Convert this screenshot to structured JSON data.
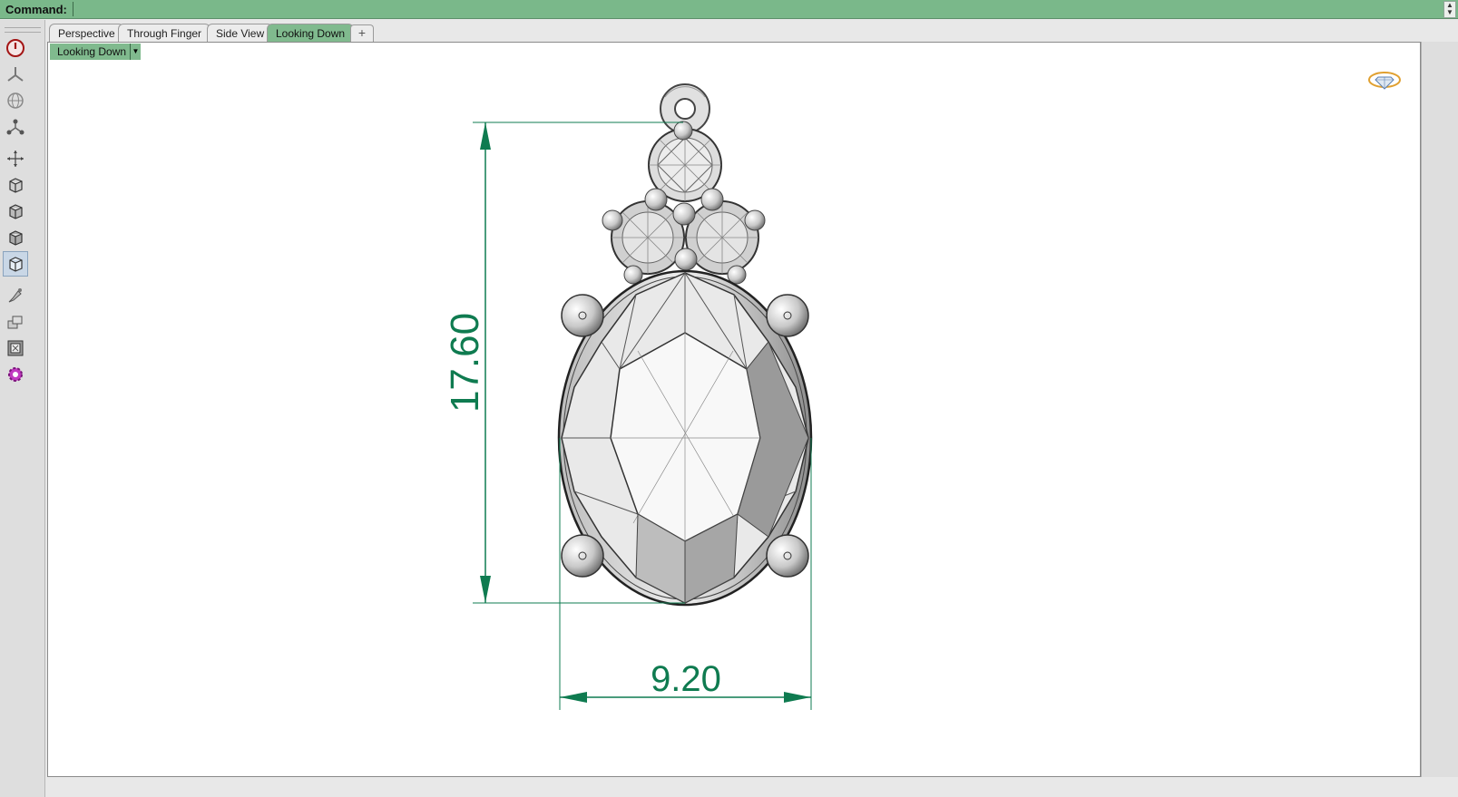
{
  "command_bar": {
    "label": "Command:",
    "value": ""
  },
  "tabs": [
    {
      "label": "Perspective"
    },
    {
      "label": "Through Finger"
    },
    {
      "label": "Side View"
    },
    {
      "label": "Looking Down"
    }
  ],
  "active_tab": "Looking Down",
  "viewport": {
    "label": "Looking Down",
    "dimensions": {
      "height": "17.60",
      "width": "9.20"
    }
  },
  "toolbar": {
    "icons": [
      "power-icon",
      "axis-tripod-icon",
      "globe-icon",
      "nodes-icon",
      "move-gumball-icon",
      "box-view-icon",
      "box-view-icon",
      "box-view-icon",
      "box-view-icon",
      "paintbrush-icon",
      "layers-edit-icon",
      "frame-icon",
      "gear-icon"
    ]
  },
  "colors": {
    "command_bar": "#7ab88a",
    "active_tab": "#80ba8e",
    "dimension": "#0f7b50"
  }
}
